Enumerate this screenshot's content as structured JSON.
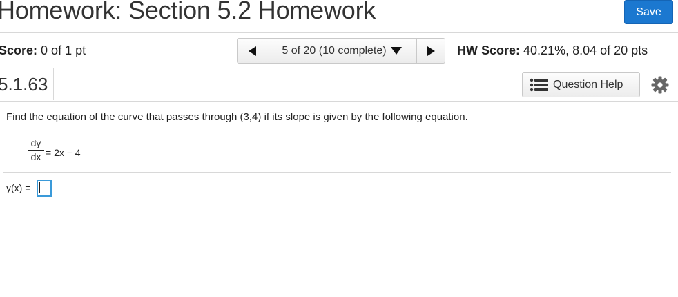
{
  "header": {
    "title": "Homework: Section 5.2 Homework",
    "save_label": "Save"
  },
  "score": {
    "label": "Score:",
    "value": "0 of 1 pt"
  },
  "nav": {
    "position_text": "5 of 20 (10 complete)",
    "prev_icon": "triangle-left-icon",
    "next_icon": "triangle-right-icon",
    "dropdown_icon": "triangle-down-icon"
  },
  "hw_score": {
    "label": "HW Score:",
    "value": "40.21%, 8.04 of 20 pts"
  },
  "question": {
    "number": "5.1.63",
    "help_label": "Question Help",
    "help_icon": "list-icon",
    "settings_icon": "gear-icon",
    "prompt": "Find the equation of the curve that passes through (3,4) if its slope is given by the following equation.",
    "equation": {
      "numerator": "dy",
      "denominator": "dx",
      "rhs": "= 2x − 4"
    },
    "answer_label": "y(x) =",
    "answer_value": ""
  },
  "colors": {
    "save_bg": "#1b78d0",
    "input_border": "#3a9ad9",
    "rule": "#d8d8d8"
  }
}
